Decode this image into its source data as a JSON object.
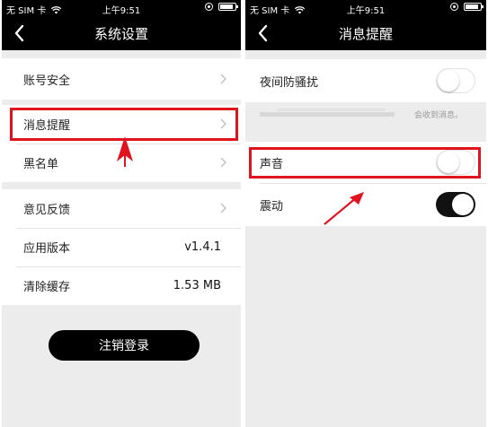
{
  "status_bar": {
    "carrier": "无 SIM 卡",
    "time": "上午9:51"
  },
  "left_screen": {
    "nav_title": "系统设置",
    "items": [
      {
        "label": "账号安全"
      },
      {
        "label": "消息提醒"
      },
      {
        "label": "黑名单"
      },
      {
        "label": "意见反馈"
      },
      {
        "label": "应用版本",
        "value": "v1.4.1"
      },
      {
        "label": "清除缓存",
        "value": "1.53 MB"
      }
    ],
    "logout_label": "注销登录"
  },
  "right_screen": {
    "nav_title": "消息提醒",
    "night_mode_label": "夜间防骚扰",
    "night_mode_on": false,
    "hint_text": "会收到消息。",
    "sound_label": "声音",
    "sound_on": false,
    "vibrate_label": "震动",
    "vibrate_on": true
  },
  "colors": {
    "highlight": "#e0141e",
    "nav_bg": "#000000",
    "page_bg": "#ececec"
  },
  "icons": [
    "back-chevron-icon",
    "chevron-right-icon",
    "wifi-icon",
    "lock-rotation-icon",
    "battery-icon"
  ]
}
